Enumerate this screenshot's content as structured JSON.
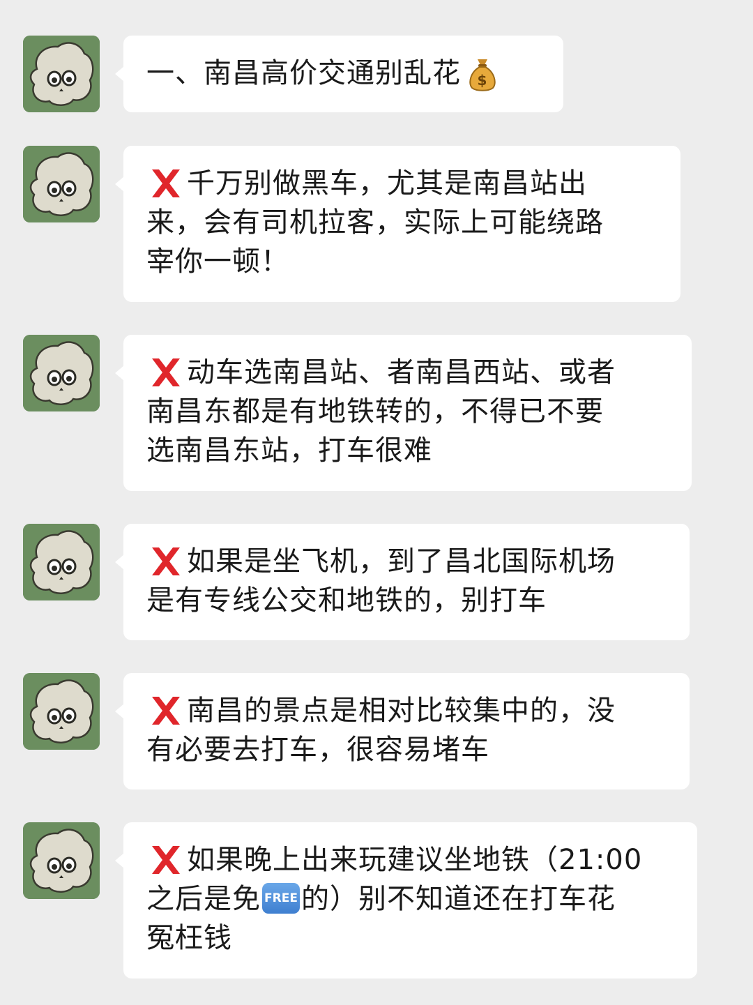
{
  "colors": {
    "background": "#ededed",
    "bubble": "#ffffff",
    "text": "#1a1a1a",
    "avatar_bg": "#6b8e5f",
    "x_mark": "#e0262b",
    "free_badge": "#4a8ad8"
  },
  "icons": {
    "avatar": "skull-avatar-icon",
    "title_emoji": "money-bag-icon",
    "cross": "cross-mark-icon",
    "free": "free-button-icon"
  },
  "messages": [
    {
      "lines": [
        "一、南昌高价交通别乱花"
      ]
    },
    {
      "lines": [
        "千万别做黑车，尤其是南昌站出",
        "来，会有司机拉客，实际上可能绕路",
        "宰你一顿！"
      ]
    },
    {
      "lines": [
        "动车选南昌站、者南昌西站、或者",
        "南昌东都是有地铁转的，不得已不要",
        "选南昌东站，打车很难"
      ]
    },
    {
      "lines": [
        "如果是坐飞机，到了昌北国际机场",
        "是有专线公交和地铁的，别打车"
      ]
    },
    {
      "lines": [
        "南昌的景点是相对比较集中的，没",
        "有必要去打车，很容易堵车"
      ]
    },
    {
      "lines": [
        "如果晚上出来玩建议坐地铁（21:00",
        "之后是免",
        "的）别不知道还在打车花",
        "冤枉钱"
      ],
      "free_label": "FREE"
    }
  ]
}
